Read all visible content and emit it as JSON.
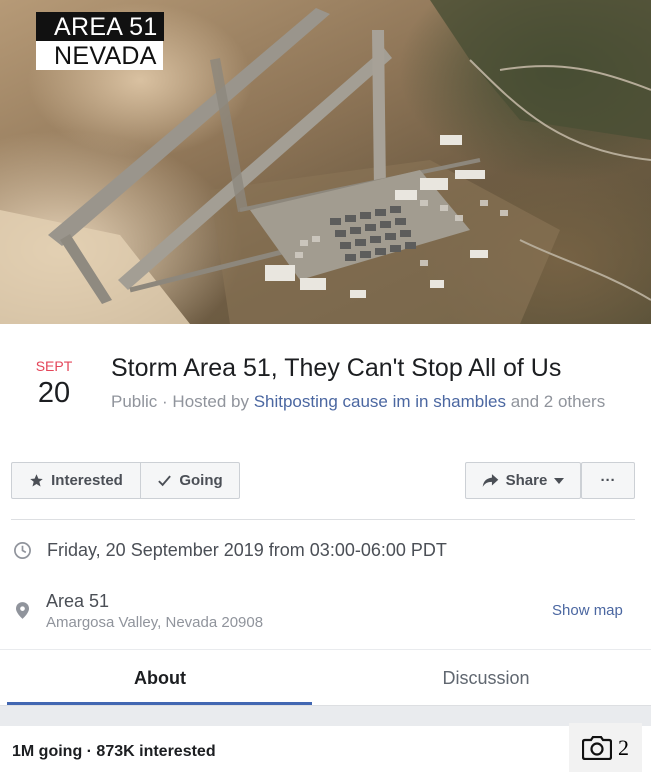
{
  "cover": {
    "caption_line1": "AREA 51",
    "caption_line2": "NEVADA"
  },
  "event": {
    "date_month": "SEPT",
    "date_day": "20",
    "title": "Storm Area 51, They Can't Stop All of Us",
    "visibility": "Public",
    "hosted_by_prefix": " · Hosted by ",
    "host": "Shitposting cause im in shambles",
    "hosted_by_suffix": " and 2 others"
  },
  "actions": {
    "interested_label": "Interested",
    "going_label": "Going",
    "share_label": "Share",
    "more_label": "···"
  },
  "details": {
    "time": "Friday, 20 September 2019 from 03:00-06:00 PDT",
    "location_name": "Area 51",
    "location_address": "Amargosa Valley, Nevada 20908",
    "show_map_label": "Show map"
  },
  "tabs": [
    {
      "label": "About",
      "active": true
    },
    {
      "label": "Discussion",
      "active": false
    }
  ],
  "footer": {
    "counts": "1M going · 873K interested",
    "photo_count": "2"
  },
  "icons": {
    "interested": "star-icon",
    "going": "checkmark-icon",
    "share": "share-arrow-icon",
    "share_dropdown": "caret-down-icon",
    "time": "clock-icon",
    "location": "map-pin-icon",
    "gallery": "camera-icon"
  },
  "colors": {
    "date_month": "#e4465a",
    "link": "#4b67a1",
    "tab_underline": "#4267b2"
  }
}
